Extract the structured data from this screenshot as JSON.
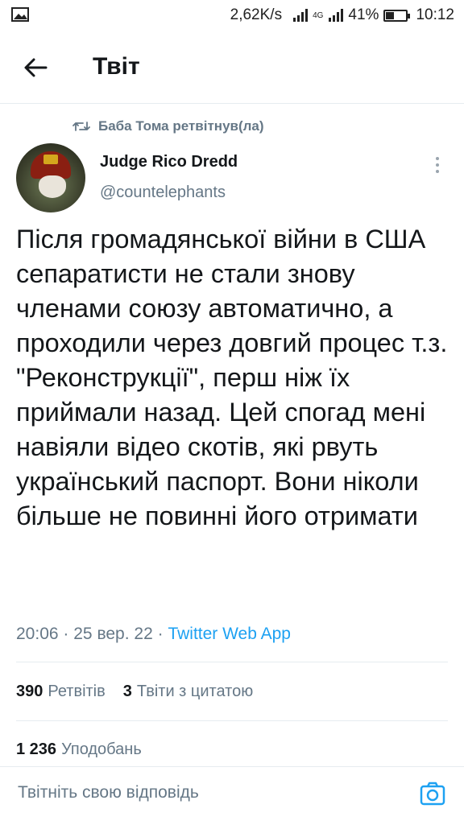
{
  "status_bar": {
    "speed": "2,62K/s",
    "network": "4G",
    "battery": "41%",
    "battery_level": 0.41,
    "time": "10:12"
  },
  "header": {
    "title": "Твіт"
  },
  "retweet_context": "Баба Тома ретвітнув(ла)",
  "author": {
    "name": "Judge Rico Dredd",
    "handle": "@countelephants"
  },
  "tweet": {
    "text": "Після громадянської війни в США сепаратисти не стали знову членами союзу автоматично, а проходили через довгий процес т.з. \"Реконструкції\", перш ніж їх приймали назад. Цей спогад мені навіяли відео скотів, які рвуть український паспорт. Вони ніколи більше не повинні його отримати",
    "time": "20:06",
    "date": "25 вер. 22",
    "source": "Twitter Web App",
    "sep": "·"
  },
  "stats": {
    "retweets_count": "390",
    "retweets_label": "Ретвітів",
    "quotes_count": "3",
    "quotes_label": "Твіти з цитатою",
    "likes_count": "1 236",
    "likes_label": "Уподобань"
  },
  "reply": {
    "placeholder": "Твітніть свою відповідь"
  },
  "colors": {
    "accent": "#1da1f2",
    "secondary_text": "#657786",
    "divider": "#e6ecf0"
  }
}
